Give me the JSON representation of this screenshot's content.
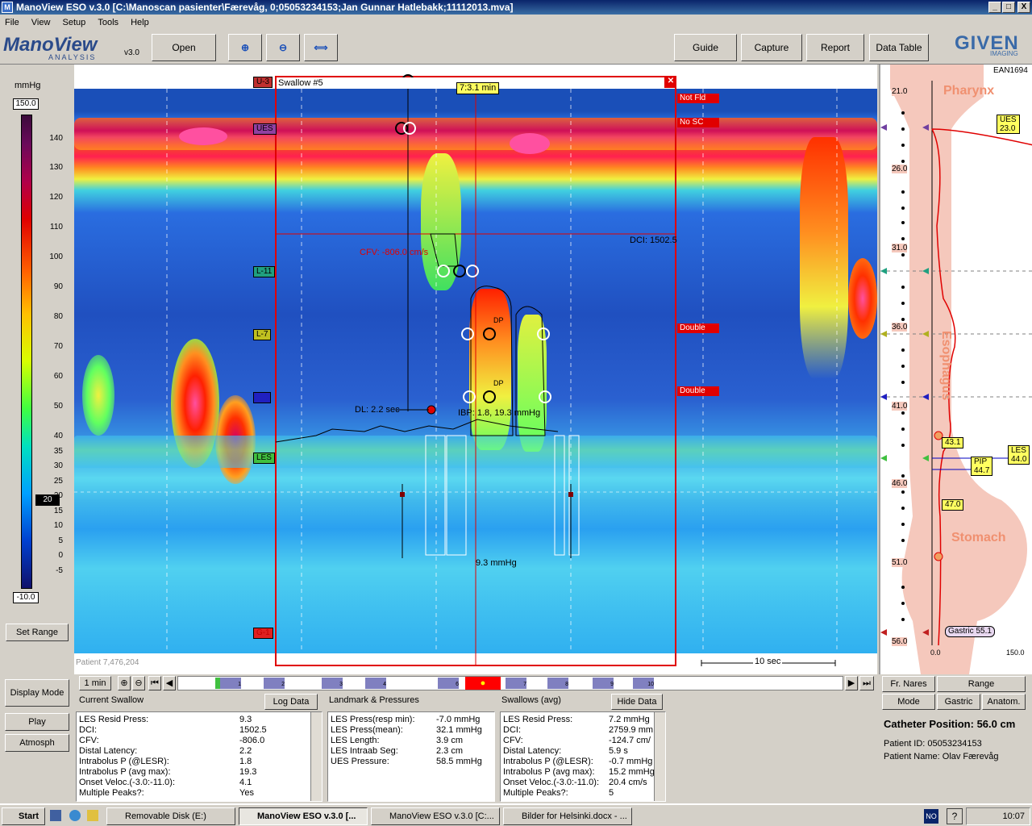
{
  "window": {
    "title": "ManoView ESO v.3.0 [C:\\Manoscan pasienter\\Færevåg, 0;05053234153;Jan Gunnar Hatlebakk;11112013.mva]",
    "min": "_",
    "max": "□",
    "close": "X"
  },
  "menu": [
    "File",
    "View",
    "Setup",
    "Tools",
    "Help"
  ],
  "toolbar": {
    "logo": "ManoView",
    "logo_sub": "ANALYSIS",
    "version": "v3.0",
    "open": "Open",
    "guide": "Guide",
    "capture": "Capture",
    "report": "Report",
    "data_table": "Data Table",
    "brand": "GIVEN",
    "brand_sub": "IMAGING"
  },
  "legend": {
    "unit": "mmHg",
    "max": "150.0",
    "min": "-10.0",
    "set_range": "Set Range",
    "ticks": [
      "140",
      "130",
      "120",
      "110",
      "100",
      "90",
      "80",
      "70",
      "60",
      "50",
      "40",
      "35",
      "30",
      "25",
      "20",
      "15",
      "10",
      "5",
      "0",
      "-5"
    ],
    "marker": "20"
  },
  "plot": {
    "swallow_title": "Swallow #5",
    "time_label": "7:3.1 min",
    "dci": "DCI: 1502.5",
    "cfv": "CFV: -806.0 cm/s",
    "dl": "DL: 2.2 sec",
    "ibp": "IBP: 1.8, 19.3 mmHg",
    "baseline": "9.3 mmHg",
    "dp1": "DP",
    "dp2": "DP",
    "patient": "Patient 7,476,204",
    "scale": "10 sec",
    "tags": {
      "not_fld": "Not Fld",
      "no_sc": "No SC",
      "double1": "Double",
      "double2": "Double"
    },
    "landmarks": [
      "U-3",
      "UES",
      "L-11",
      "L-7",
      "L-3",
      "LES",
      "G-1"
    ]
  },
  "anatomy": {
    "id": "EAN1694",
    "pharynx": "Pharynx",
    "esophagus": "Esophagus",
    "stomach": "Stomach",
    "depths": [
      "21.0",
      "26.0",
      "31.0",
      "36.0",
      "41.0",
      "46.0",
      "51.0",
      "56.0"
    ],
    "ues": "UES",
    "ues_val": "23.0",
    "les": "LES",
    "les_val": "44.0",
    "pip": "PIP",
    "pip_val": "44.7",
    "v431": "43.1",
    "v470": "47.0",
    "gastric": "Gastric 55.1",
    "x0": "0.0",
    "x150": "150.0"
  },
  "nav": {
    "interval": "1 min",
    "swallows": [
      "1",
      "2",
      "3",
      "4",
      "5",
      "6",
      "7",
      "8",
      "9",
      "10"
    ]
  },
  "left_buttons": {
    "display_mode": "Display Mode",
    "play": "Play",
    "atmosph": "Atmosph"
  },
  "current_swallow": {
    "title": "Current Swallow",
    "log_button": "Log Data",
    "rows": [
      [
        "LES Resid Press:",
        "9.3"
      ],
      [
        "DCI:",
        "1502.5"
      ],
      [
        "CFV:",
        "-806.0"
      ],
      [
        "Distal Latency:",
        "2.2"
      ],
      [
        "Intrabolus P (@LESR):",
        "1.8"
      ],
      [
        "Intrabolus P (avg max):",
        "19.3"
      ],
      [
        "Onset Veloc.(-3.0:-11.0):",
        "4.1"
      ],
      [
        "Multiple Peaks?:",
        "Yes"
      ]
    ]
  },
  "landmark": {
    "title": "Landmark & Pressures",
    "rows": [
      [
        "LES Press(resp min):",
        "-7.0 mmHg"
      ],
      [
        "LES Press(mean):",
        "32.1 mmHg"
      ],
      [
        "LES Length:",
        "3.9 cm"
      ],
      [
        "LES Intraab Seg:",
        "2.3 cm"
      ],
      [
        "UES Pressure:",
        "58.5 mmHg"
      ]
    ]
  },
  "swallows_avg": {
    "title": "Swallows (avg)",
    "hide_button": "Hide Data",
    "rows": [
      [
        "LES Resid Press:",
        "7.2 mmHg"
      ],
      [
        "DCI:",
        "2759.9 mm"
      ],
      [
        "CFV:",
        "-124.7 cm/"
      ],
      [
        "Distal Latency:",
        "5.9 s"
      ],
      [
        "Intrabolus P (@LESR):",
        "-0.7 mmHg"
      ],
      [
        "Intrabolus P (avg max):",
        "15.2 mmHg"
      ],
      [
        "Onset Veloc.(-3.0:-11.0):",
        "20.4 cm/s"
      ],
      [
        "Multiple Peaks?:",
        "5"
      ]
    ]
  },
  "right_controls": {
    "fr_nares": "Fr. Nares",
    "range": "Range",
    "mode": "Mode",
    "gastric": "Gastric",
    "anatom": "Anatom.",
    "catheter": "Catheter Position: 56.0 cm",
    "patient_id": "Patient ID: 05053234153",
    "patient_name": "Patient Name: Olav Færevåg"
  },
  "taskbar": {
    "start": "Start",
    "tasks": [
      "Removable Disk (E:)",
      "ManoView ESO v.3.0 [...",
      "ManoView ESO v.3.0 [C:...",
      "Bilder for Helsinki.docx - ..."
    ],
    "lang": "NO",
    "clock": "10:07"
  },
  "colors": {
    "accent_red": "#e00000",
    "tag_yellow": "#ffff60",
    "anatomy_pink": "#f5c8bc",
    "title_blue": "#0a246a"
  }
}
